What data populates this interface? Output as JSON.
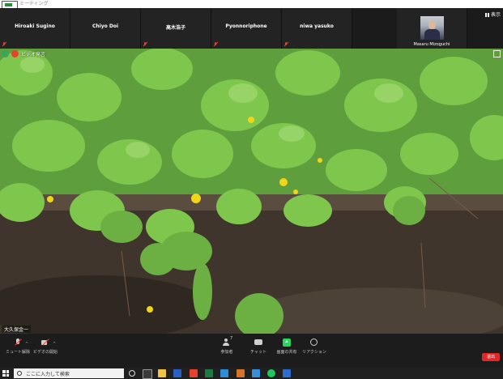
{
  "window": {
    "title": "ミーティング"
  },
  "gallery": {
    "participants": [
      {
        "name": "Hiroaki Sugino",
        "muted": true
      },
      {
        "name": "Chiyo Doi",
        "muted": false
      },
      {
        "name": "高木浩子",
        "muted": true
      },
      {
        "name": "Pyonnoriphone",
        "muted": true
      },
      {
        "name": "niwa yasuko",
        "muted": true
      }
    ],
    "photo_participant": {
      "name": "Masaru Mizoguchi"
    },
    "view_label": "表示"
  },
  "video": {
    "top_label": "ビデオ発言",
    "speaker": "大久保金一"
  },
  "controls": {
    "mute": "ミュート解除",
    "video": "ビデオの開始",
    "participants": "参加者",
    "participants_count": "7",
    "chat": "チャット",
    "share": "画面の共有",
    "reactions": "リアクション",
    "end": "退出"
  },
  "taskbar": {
    "search_placeholder": "ここに入力して検索"
  },
  "colors": {
    "end": "#e02828",
    "share": "#23d959",
    "muted": "#e8412e"
  }
}
